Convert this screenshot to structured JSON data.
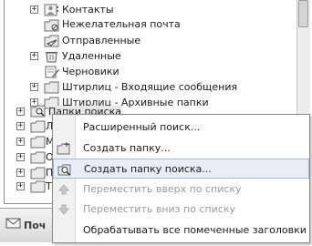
{
  "folders": [
    {
      "label": "Контакты",
      "expander": "+",
      "icon": "contacts-folder-icon"
    },
    {
      "label": "Нежелательная почта",
      "expander": "",
      "icon": "junk-mail-folder-icon"
    },
    {
      "label": "Отправленные",
      "expander": "",
      "icon": "sent-items-folder-icon"
    },
    {
      "label": "Удаленные",
      "expander": "+",
      "icon": "deleted-items-folder-icon"
    },
    {
      "label": "Черновики",
      "expander": "",
      "icon": "drafts-folder-icon"
    },
    {
      "label": "Штирлиц - Входящие сообщения",
      "expander": "+",
      "icon": "folder-icon"
    },
    {
      "label": "Штирлиц - Архивные папки",
      "expander": "+",
      "icon": "folder-icon"
    },
    {
      "label": "Папки поиска",
      "expander": "+",
      "icon": "search-folders-icon"
    },
    {
      "label": "Л",
      "expander": "+",
      "icon": "folder-icon"
    },
    {
      "label": "М",
      "expander": "+",
      "icon": "folder-icon"
    },
    {
      "label": "О",
      "expander": "+",
      "icon": "folder-icon"
    },
    {
      "label": "П",
      "expander": "+",
      "icon": "folder-icon"
    },
    {
      "label": "Т",
      "expander": "+",
      "icon": "folder-icon"
    }
  ],
  "bottom_bar": {
    "label": "Поч",
    "icon": "mail-icon"
  },
  "context_menu": {
    "items": [
      {
        "label": "Расширенный поиск...",
        "disabled": false,
        "icon": ""
      },
      {
        "label": "Создать папку...",
        "disabled": false,
        "icon": "new-folder-icon"
      },
      {
        "label": "Создать папку поиска...",
        "disabled": false,
        "icon": "new-search-folder-icon"
      },
      {
        "label": "Переместить вверх по списку",
        "disabled": true,
        "icon": "move-up-icon"
      },
      {
        "label": "Переместить вниз по списку",
        "disabled": true,
        "icon": "move-down-icon"
      },
      {
        "label": "Обрабатывать все помеченные заголовки",
        "disabled": false,
        "icon": ""
      }
    ]
  },
  "colors": {
    "highlight": "#e8eef7",
    "disabled_text": "#9a9a9a",
    "border": "#8a8a8a"
  }
}
